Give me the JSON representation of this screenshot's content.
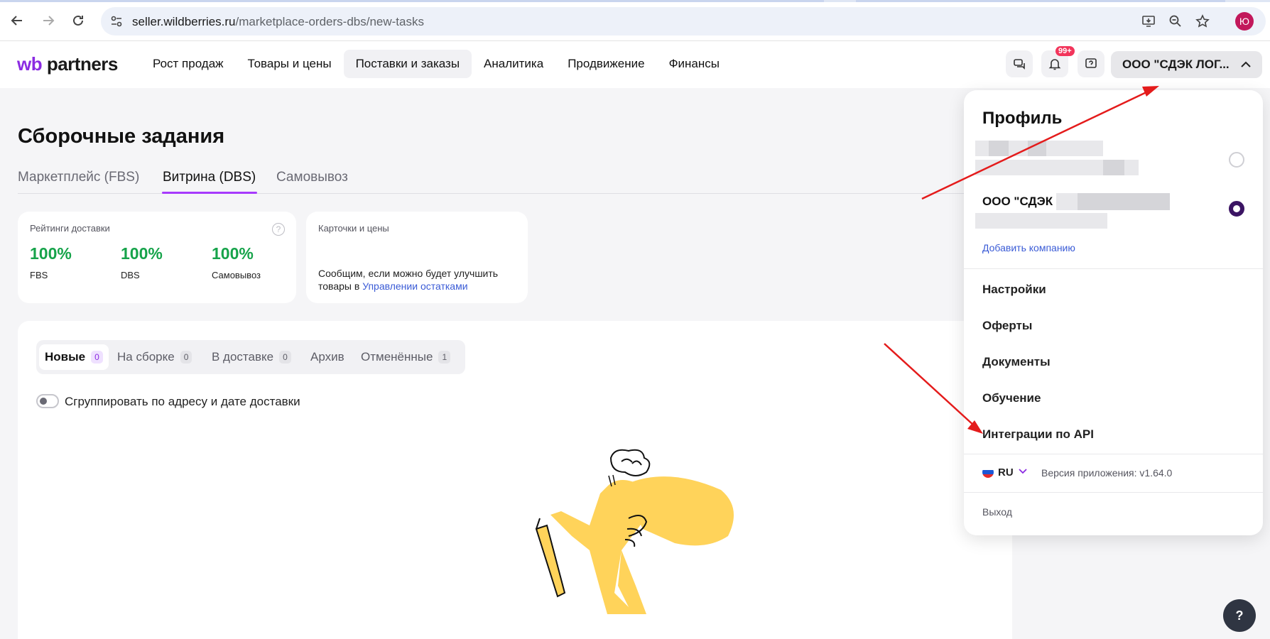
{
  "browser": {
    "url_host": "seller.wildberries.ru",
    "url_path": "/marketplace-orders-dbs/new-tasks",
    "profile_initial": "Ю",
    "icons": [
      "back-icon",
      "forward-icon",
      "reload-icon",
      "site-info-icon",
      "install-icon",
      "zoom-icon",
      "star-icon"
    ]
  },
  "header": {
    "logo_wb": "wb",
    "logo_partners": "partners",
    "nav": [
      "Рост продаж",
      "Товары и цены",
      "Поставки и заказы",
      "Аналитика",
      "Продвижение",
      "Финансы"
    ],
    "active_nav_index": 2,
    "notif_badge": "99+",
    "company_button": "ООО \"СДЭК ЛОГ..."
  },
  "page": {
    "title": "Сборочные задания",
    "tabs": [
      "Маркетплейс (FBS)",
      "Витрина (DBS)",
      "Самовывоз"
    ],
    "active_tab_index": 1
  },
  "ratings_card": {
    "title": "Рейтинги доставки",
    "help": "?",
    "items": [
      {
        "value": "100%",
        "label": "FBS"
      },
      {
        "value": "100%",
        "label": "DBS"
      },
      {
        "value": "100%",
        "label": "Самовывоз"
      }
    ]
  },
  "prices_card": {
    "title": "Карточки и цены",
    "text": "Сообщим, если можно будет улучшить товары в ",
    "link": "Управлении остатками"
  },
  "status_tabs": [
    {
      "label": "Новые",
      "count": "0"
    },
    {
      "label": "На сборке",
      "count": "0"
    },
    {
      "label": "В доставке",
      "count": "0"
    },
    {
      "label": "Архив",
      "count": ""
    },
    {
      "label": "Отменённые",
      "count": "1"
    }
  ],
  "group_toggle": {
    "label": "Сгруппировать по адресу и дате доставки",
    "on": false
  },
  "profile_menu": {
    "title": "Профиль",
    "company_name": "ООО \"СДЭК",
    "add_company": "Добавить компанию",
    "items": [
      "Настройки",
      "Оферты",
      "Документы",
      "Обучение",
      "Интеграции по API"
    ],
    "lang": "RU",
    "version": "Версия приложения: v1.64.0",
    "logout": "Выход"
  },
  "help_fab": "?",
  "colors": {
    "brand": "#8b2be2",
    "accent_underline": "#a73afd",
    "rating_green": "#16a34a",
    "link_blue": "#3a5bd6",
    "annotation_red": "#e41b1b",
    "illustration_yellow": "#ffd35a"
  }
}
